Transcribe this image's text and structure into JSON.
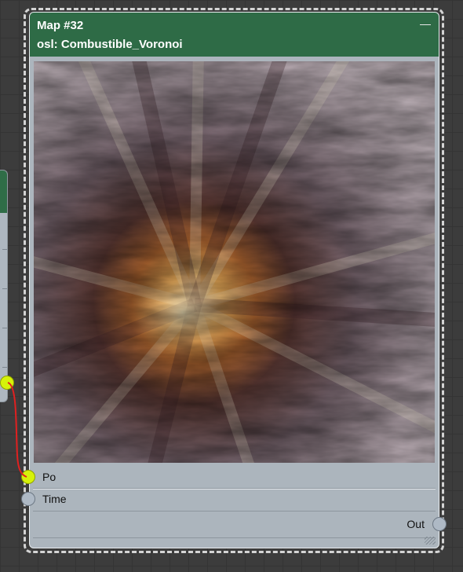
{
  "node": {
    "title": "Map #32",
    "subtitle": "osl: Combustible_Voronoi",
    "preview_icon": "voronoi-fire-preview",
    "inputs": [
      {
        "label": "Po",
        "connected": true
      },
      {
        "label": "Time",
        "connected": false
      }
    ],
    "output": {
      "label": "Out"
    }
  },
  "colors": {
    "header": "#2e6b46",
    "node_body": "#acb5bd",
    "socket_connected": "#d6f20a",
    "socket_idle": "#aeb9c5",
    "wire": "#e02020",
    "canvas": "#3c3c3c"
  }
}
